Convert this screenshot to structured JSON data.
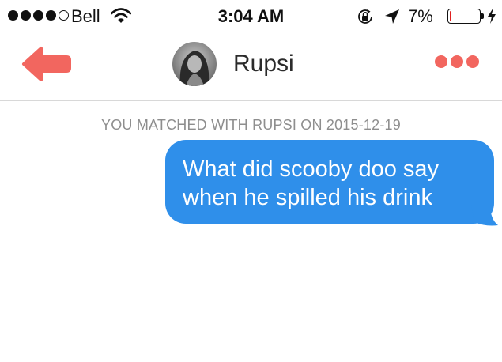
{
  "status_bar": {
    "carrier": "Bell",
    "time": "3:04 AM",
    "battery_percent": "7%",
    "battery_level": 0.07,
    "signal_bars_filled": 4,
    "signal_bars_total": 5,
    "icons": [
      "wifi-icon",
      "orientation-lock-icon",
      "location-icon",
      "charging-bolt-icon"
    ]
  },
  "header": {
    "contact_name": "Rupsi",
    "back_icon": "arrow-left-icon",
    "more_icon": "ellipsis-icon",
    "accent_color": "#f2665f"
  },
  "conversation": {
    "match_label": "YOU MATCHED WITH RUPSI ON 2015-12-19",
    "messages": [
      {
        "sender": "me",
        "text": "What did scooby doo say\nwhen he spilled his drink",
        "bubble_color": "#2f8fea"
      }
    ]
  }
}
